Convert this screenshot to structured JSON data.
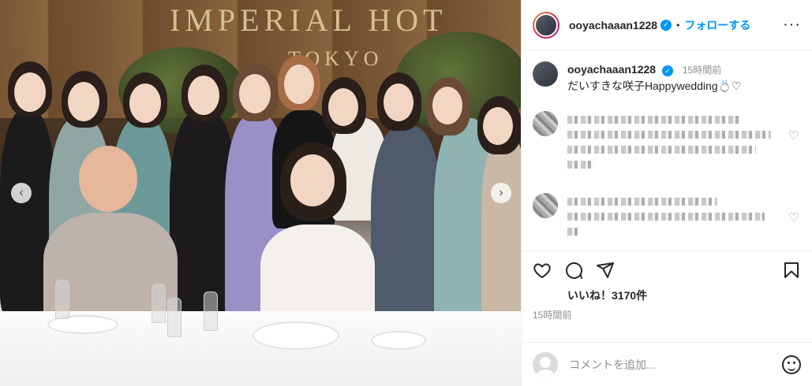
{
  "photo": {
    "sign_line1": "IMPERIAL HOT",
    "sign_line2": "TOKYO",
    "prev_icon": "chevron-left-icon",
    "next_icon": "chevron-right-icon"
  },
  "header": {
    "username": "ooyachaaan1228",
    "verified_icon": "verified-badge-icon",
    "separator": "•",
    "follow_label": "フォローする",
    "more_icon": "more-options-icon"
  },
  "caption": {
    "username": "ooyachaaan1228",
    "time": "15時間前",
    "text": "だいすきな咲子Happywedding💍♡"
  },
  "actions": {
    "like_icon": "heart-icon",
    "comment_icon": "comment-icon",
    "share_icon": "share-icon",
    "save_icon": "bookmark-icon"
  },
  "likes": "いいね！3170件",
  "posted": "15時間前",
  "comment_input": {
    "placeholder": "コメントを追加..."
  },
  "colors": {
    "accent": "#0095f6",
    "text": "#262626",
    "muted": "#8e8e8e"
  }
}
